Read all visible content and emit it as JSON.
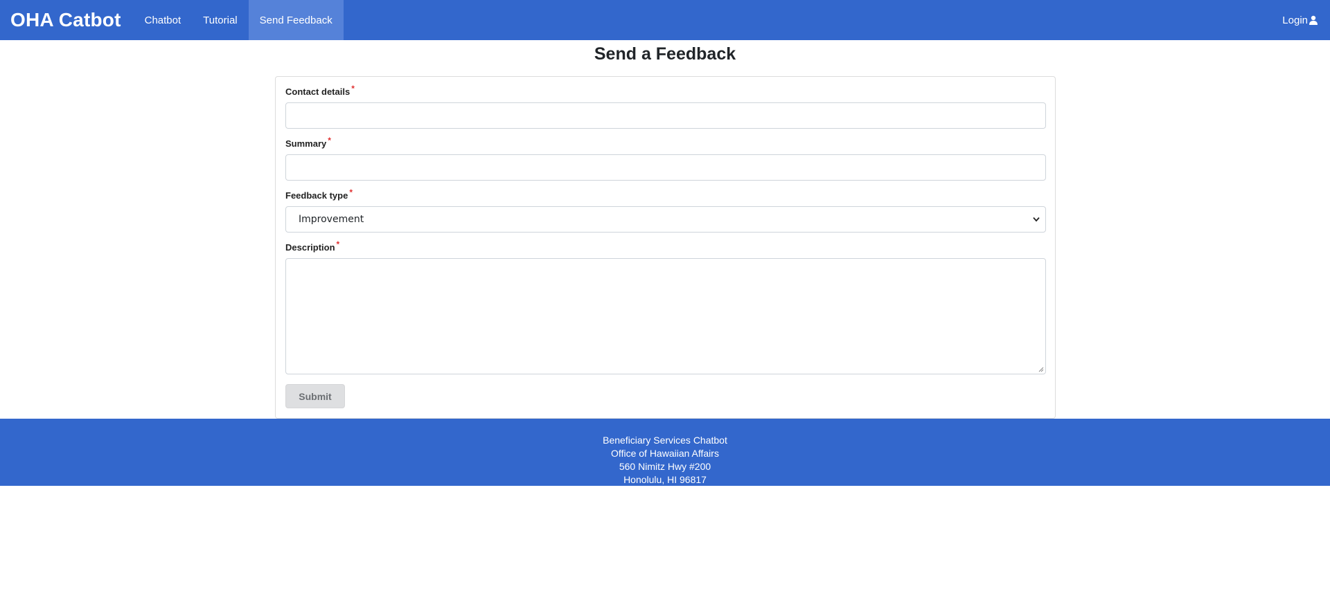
{
  "navbar": {
    "brand": "OHA Catbot",
    "items": [
      {
        "label": "Chatbot"
      },
      {
        "label": "Tutorial"
      },
      {
        "label": "Send Feedback"
      }
    ],
    "login_label": "Login",
    "bg_color": "#3367cc"
  },
  "page": {
    "title": "Send a Feedback"
  },
  "form": {
    "required_marker": "*",
    "contact": {
      "label": "Contact details",
      "value": ""
    },
    "summary": {
      "label": "Summary",
      "value": ""
    },
    "feedback_type": {
      "label": "Feedback type",
      "selected": "Improvement"
    },
    "description": {
      "label": "Description",
      "value": ""
    },
    "submit_label": "Submit"
  },
  "footer": {
    "lines": [
      "Beneficiary Services Chatbot",
      "Office of Hawaiian Affairs",
      "560 Nimitz Hwy #200",
      "Honolulu, HI 96817"
    ]
  }
}
